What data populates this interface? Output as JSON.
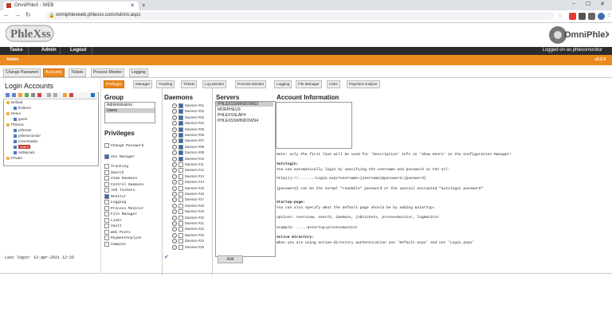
{
  "browser": {
    "tab_title": "OmniPhleX - WEB",
    "url": "omniphlexweb.phlesss.com/Admin.aspx"
  },
  "nav": {
    "tasks": "Tasks",
    "admin": "Admin",
    "logout": "Logout",
    "logged_on": "Logged on as phlessmonitor"
  },
  "orange": {
    "left": "Admin",
    "version": "v3.2.0"
  },
  "subtabs": [
    "Change Password",
    "Accounts",
    "Tickets",
    "Process Monitor",
    "Logging"
  ],
  "left": {
    "title": "Login Accounts",
    "tree": [
      {
        "label": "Default",
        "type": "folder",
        "level": 0
      },
      {
        "label": "fieldemr",
        "type": "user",
        "level": 1
      },
      {
        "label": "Demo",
        "type": "folder",
        "level": 0
      },
      {
        "label": "guest",
        "type": "user",
        "level": 1
      },
      {
        "label": "Phlexss",
        "type": "folder",
        "level": 0
      },
      {
        "label": "phlessw",
        "type": "user",
        "level": 1
      },
      {
        "label": "phlessmonitor",
        "type": "user",
        "level": 1
      },
      {
        "label": "t.lovemadan",
        "type": "user",
        "level": 1
      },
      {
        "label": "user1",
        "type": "user",
        "level": 1,
        "selected": true
      },
      {
        "label": "redlayouts",
        "type": "user",
        "level": 1
      },
      {
        "label": "Private",
        "type": "folder",
        "level": 0
      }
    ],
    "last_login": "Last login: 12-apr-2021 12:26"
  },
  "inner_tabs": [
    "Privileges",
    "Manager",
    "Tracking",
    "Tickets",
    "Log Monitor",
    "Process Monitor",
    "Logging",
    "File Manager",
    "Links",
    "Payment Analyze"
  ],
  "group": {
    "title": "Group",
    "items": [
      "Administrators",
      "Users"
    ]
  },
  "privileges": {
    "title": "Privileges",
    "items": [
      {
        "label": "Change Password",
        "checked": false
      },
      {
        "label": "Use Manager",
        "checked": true
      },
      {
        "label": "Tracking",
        "checked": false
      },
      {
        "label": "Search",
        "checked": false
      },
      {
        "label": "View Daemons",
        "checked": false
      },
      {
        "label": "Control Daemons",
        "checked": false
      },
      {
        "label": "Job Tickets",
        "checked": false
      },
      {
        "label": "Monitor",
        "checked": true
      },
      {
        "label": "Logging",
        "checked": false
      },
      {
        "label": "Process Monitor",
        "checked": false
      },
      {
        "label": "File Manager",
        "checked": false
      },
      {
        "label": "Links",
        "checked": false
      },
      {
        "label": "Vault",
        "checked": false
      },
      {
        "label": "Web Posts",
        "checked": false
      },
      {
        "label": "PaymentAnalyze",
        "checked": false
      },
      {
        "label": "Compost",
        "checked": false
      }
    ]
  },
  "daemons": {
    "title": "Daemons",
    "items": [
      "Daemon #01",
      "Daemon #02",
      "Daemon #03",
      "Daemon #04",
      "Daemon #05",
      "Daemon #06",
      "Daemon #07",
      "Daemon #08",
      "Daemon #09",
      "Daemon #10",
      "Daemon #11",
      "Daemon #12",
      "Daemon #13",
      "Daemon #14",
      "Daemon #15",
      "Daemon #16",
      "Daemon #17",
      "Daemon #18",
      "Daemon #19",
      "Daemon #20",
      "Daemon #21",
      "Daemon #22",
      "Daemon #23",
      "Daemon #24",
      "Daemon #25"
    ],
    "checked_count": 10
  },
  "servers": {
    "title": "Servers",
    "items": [
      "PHLEXSSWINDOWS3",
      "MORPHEUS",
      "PHLEXSSLAP4",
      "PHLEXSSWINDOWS4"
    ],
    "add_label": "Add"
  },
  "account_info": {
    "title": "Account Information",
    "note": "Note: only the first line will be used for 'Description' info in 'Show Users' in the Configuration Manager!",
    "autologin_title": "Autologin:",
    "autologin_text": "You can automatically login by specifying the username and password in the url:",
    "autologin_example": "http(s)://......./Login.aspx?username={username}&password={password}",
    "autologin_password": "{password} can be the normal \"readable\" password or the special encrypted \"autologin password\"",
    "startup_title": "Startup-page:",
    "startup_text": "You can also specify what the default page should be by adding &startup=",
    "startup_options": "options: overview, search, daemons, jobtickets, processmonitor, logmonitor",
    "startup_example": "example: .....&startup=processmonitor",
    "ad_title": "Active Directory:",
    "ad_text": "When you are using active-directory authentication use 'Default.aspx' and not 'Login.aspx'"
  }
}
